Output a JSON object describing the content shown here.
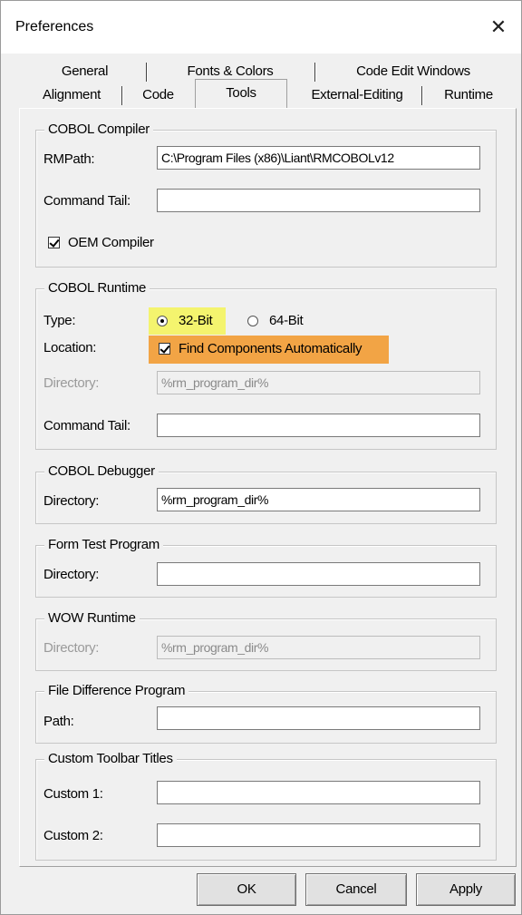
{
  "window": {
    "title": "Preferences",
    "close_glyph": "✕"
  },
  "tabs": {
    "back_row": [
      "General",
      "Fonts & Colors",
      "Code Edit Windows"
    ],
    "front_row": [
      "Alignment",
      "Code",
      "Tools",
      "External-Editing",
      "Runtime"
    ],
    "active": "Tools"
  },
  "cobol_compiler": {
    "legend": "COBOL Compiler",
    "rmpath_label": "RMPath:",
    "rmpath_value": "C:\\Program Files (x86)\\Liant\\RMCOBOLv12",
    "command_tail_label": "Command Tail:",
    "command_tail_value": "",
    "oem_label": "OEM Compiler",
    "oem_checked": true
  },
  "cobol_runtime": {
    "legend": "COBOL Runtime",
    "type_label": "Type:",
    "option_32": "32-Bit",
    "option_64": "64-Bit",
    "selected": "32-Bit",
    "location_label": "Location:",
    "find_auto_label": "Find Components Automatically",
    "find_auto_checked": true,
    "directory_label": "Directory:",
    "directory_value": "%rm_program_dir%",
    "command_tail_label": "Command Tail:",
    "command_tail_value": ""
  },
  "cobol_debugger": {
    "legend": "COBOL Debugger",
    "directory_label": "Directory:",
    "directory_value": "%rm_program_dir%"
  },
  "form_test": {
    "legend": "Form Test Program",
    "directory_label": "Directory:",
    "directory_value": ""
  },
  "wow_runtime": {
    "legend": "WOW Runtime",
    "directory_label": "Directory:",
    "directory_value": "%rm_program_dir%"
  },
  "file_diff": {
    "legend": "File Difference Program",
    "path_label": "Path:",
    "path_value": ""
  },
  "custom_toolbar": {
    "legend": "Custom Toolbar Titles",
    "custom1_label": "Custom 1:",
    "custom1_value": "",
    "custom2_label": "Custom 2:",
    "custom2_value": ""
  },
  "buttons": {
    "ok": "OK",
    "cancel": "Cancel",
    "apply": "Apply"
  },
  "colors": {
    "highlight_yellow": "#f4f46e",
    "highlight_orange": "#f2a445"
  }
}
